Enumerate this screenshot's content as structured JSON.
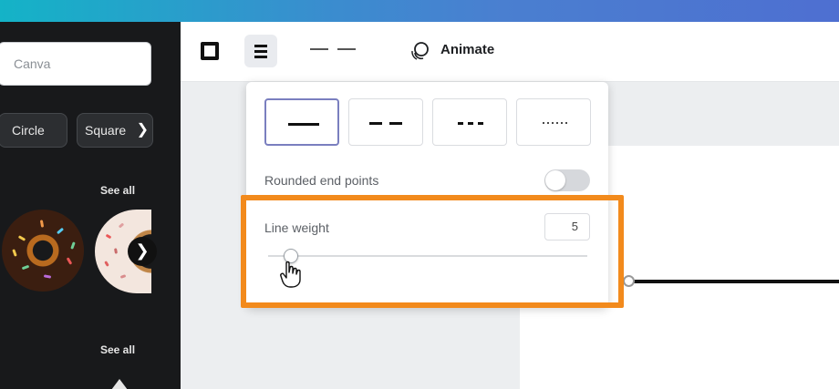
{
  "colors": {
    "accent_highlight": "#f28a1c",
    "sidebar_bg": "#18191b",
    "topbar_start": "#14b3c7",
    "topbar_end": "#4e6fd1"
  },
  "sidebar": {
    "search_placeholder": "Canva",
    "chips": [
      {
        "label": "Circle"
      },
      {
        "label": "Square"
      }
    ],
    "chip_next_icon": "chevron-right-icon",
    "see_all_1": "See all",
    "see_all_2": "See all",
    "next_icon": "chevron-right-icon"
  },
  "toolbar": {
    "border_icon": "border-style-icon",
    "line_style_icon": "line-style-icon",
    "dash_icon": "dash-line-icon",
    "animate_icon": "animate-icon",
    "animate_label": "Animate"
  },
  "popup": {
    "line_styles": [
      "solid",
      "long-dash",
      "short-dash",
      "dotted"
    ],
    "selected_style": "solid",
    "rounded_label": "Rounded end points",
    "rounded_on": false,
    "weight_label": "Line weight",
    "weight_value": "5",
    "slider_fraction": 0.05
  }
}
